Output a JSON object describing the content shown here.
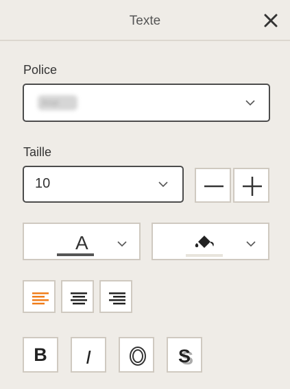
{
  "panel": {
    "title": "Texte",
    "close_icon": "close-icon"
  },
  "font": {
    "label": "Police",
    "value": "Arial",
    "dropdown_icon": "chevron-down-icon"
  },
  "size": {
    "label": "Taille",
    "value": "10",
    "dropdown_icon": "chevron-down-icon",
    "decrease_symbol": "−",
    "increase_symbol": "+"
  },
  "color": {
    "text_color_glyph": "A",
    "text_color": "#555555",
    "highlight_icon": "paint-bucket-icon",
    "highlight_color": "#e8e4dc"
  },
  "alignment": {
    "options": [
      "align-left",
      "align-center",
      "align-right"
    ],
    "selected": "align-left",
    "accent": "#f07d1a"
  },
  "style": {
    "bold": "B",
    "italic": "I",
    "outline_icon": "outline-icon",
    "shadow_icon": "shadow-icon"
  }
}
